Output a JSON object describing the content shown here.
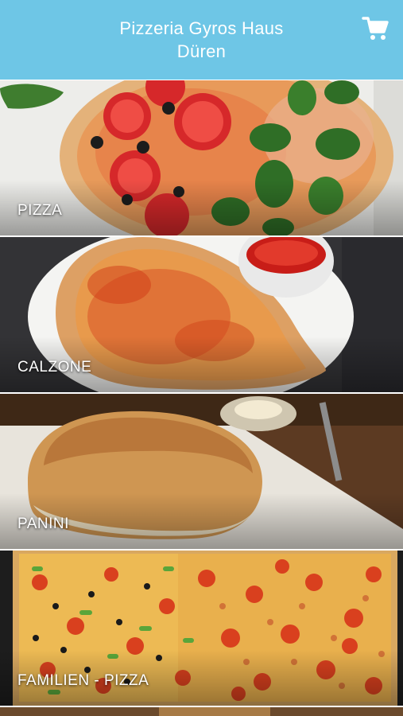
{
  "header": {
    "title_line1": "Pizzeria Gyros Haus",
    "title_line2": "Düren",
    "cart_icon": "cart-icon",
    "background_color": "#6ec6e6"
  },
  "categories": [
    {
      "label": "PIZZA"
    },
    {
      "label": "CALZONE"
    },
    {
      "label": "PANINI"
    },
    {
      "label": "FAMILIEN - PIZZA"
    }
  ]
}
